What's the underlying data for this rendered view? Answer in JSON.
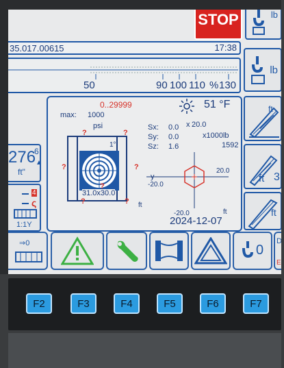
{
  "top": {
    "stop": "STOP",
    "lb_top": "lb",
    "id_value": "35.017.00615",
    "time": "17:38",
    "lb_right": "lb"
  },
  "scale": {
    "labels": [
      "50",
      "90",
      "100",
      "110",
      "%",
      "130"
    ]
  },
  "panel": {
    "range": "0..29999",
    "max_label": "max:",
    "max_value": "1000",
    "unit": "psi",
    "temp": "51 °F",
    "sx_label": "Sx:",
    "sx_value": "0.0",
    "sy_label": "Sy:",
    "sy_value": "0.0",
    "sz_label": "Sz:",
    "sz_value": "1.6",
    "x_label": "x",
    "x_value": "20.0",
    "mult": "x1000lb",
    "load": "1592",
    "y_label": "y",
    "y_neg": "-20.0",
    "right_val": "20.0",
    "bottom_neg": "-20.0",
    "ft_left": "ft",
    "ft_right": "ft",
    "angle": "1°",
    "dims": "31.0x30.0",
    "date": "2024-12-07"
  },
  "left": {
    "value": "276",
    "sup": "6",
    "unit": "ft\"",
    "red_digit": "4",
    "ratio": "1:1Y"
  },
  "right": {
    "ft1": "ft",
    "ft2": "ft",
    "ft2_num": "3",
    "ft3": "ft"
  },
  "bottom": {
    "count0": "0",
    "arrow_label": "⇒0",
    "edge_label": "D",
    "edge_red": "El"
  },
  "fkeys": [
    "F2",
    "F3",
    "F4",
    "F5",
    "F6",
    "F7"
  ],
  "colors": {
    "accent": "#1f58a6",
    "warn_green": "#3cb043",
    "alarm_red": "#d6332a",
    "key_blue": "#2b9be0"
  }
}
